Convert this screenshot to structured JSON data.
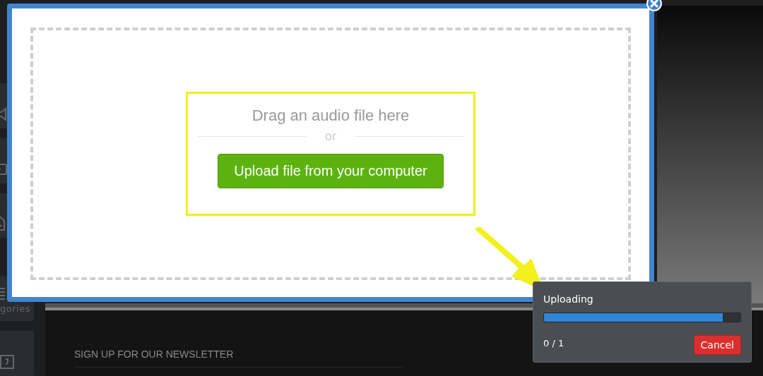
{
  "sidebar": {
    "items": [
      {
        "kind": "speaker"
      },
      {
        "kind": "play"
      },
      {
        "kind": "document"
      },
      {
        "kind": "list",
        "label": "gories"
      },
      {
        "kind": "quote"
      }
    ]
  },
  "footer": {
    "newsletter_heading": "SIGN UP FOR OUR NEWSLETTER"
  },
  "modal": {
    "drop_text": "Drag an audio file here",
    "separator": "or",
    "upload_button": "Upload file from your computer",
    "highlighted": true
  },
  "upload_panel": {
    "title": "Uploading",
    "level": 0.91,
    "count": "0 / 1",
    "cancel_button": "Cancel"
  }
}
